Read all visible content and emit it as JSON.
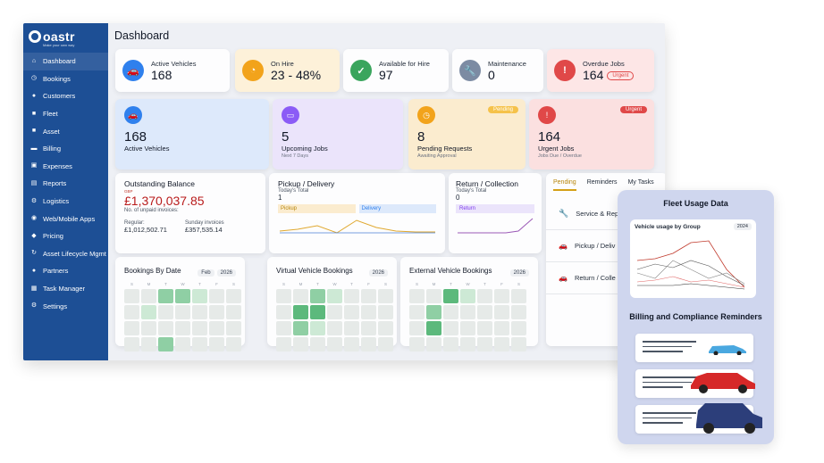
{
  "brand": {
    "name": "oastr",
    "tagline": "Make your own way"
  },
  "sidebar": {
    "items": [
      {
        "label": "Dashboard",
        "icon": "home-icon"
      },
      {
        "label": "Bookings",
        "icon": "clock-icon"
      },
      {
        "label": "Customers",
        "icon": "user-icon"
      },
      {
        "label": "Fleet",
        "icon": "truck-icon"
      },
      {
        "label": "Asset",
        "icon": "box-icon"
      },
      {
        "label": "Billing",
        "icon": "card-icon"
      },
      {
        "label": "Expenses",
        "icon": "wallet-icon"
      },
      {
        "label": "Reports",
        "icon": "report-icon"
      },
      {
        "label": "Logistics",
        "icon": "gear-icon"
      },
      {
        "label": "Web/Mobile Apps",
        "icon": "globe-icon"
      },
      {
        "label": "Pricing",
        "icon": "tag-icon"
      },
      {
        "label": "Asset Lifecycle Mgmt",
        "icon": "cycle-icon"
      },
      {
        "label": "Partners",
        "icon": "users-icon"
      },
      {
        "label": "Task Manager",
        "icon": "calendar-icon"
      },
      {
        "label": "Settings",
        "icon": "cog-icon"
      }
    ]
  },
  "header": {
    "title": "Dashboard"
  },
  "kpis": [
    {
      "label": "Active Vehicles",
      "value": "168",
      "color": "#2f80ed"
    },
    {
      "label": "On Hire",
      "value": "23 - 48%",
      "color": "#f2a31b"
    },
    {
      "label": "Available for Hire",
      "value": "97",
      "color": "#3aa55d"
    },
    {
      "label": "Maintenance",
      "value": "0",
      "color": "#7c8ba3"
    },
    {
      "label": "Overdue Jobs",
      "value": "164",
      "badge": "Urgent",
      "color": "#e04848"
    }
  ],
  "bigcards": [
    {
      "value": "168",
      "label": "Active Vehicles",
      "sub": "",
      "tag": "",
      "color": "#2f80ed",
      "bg": "#dde9fb"
    },
    {
      "value": "5",
      "label": "Upcoming Jobs",
      "sub": "Next 7 Days",
      "tag": "",
      "color": "#8b5cf6",
      "bg": "#ebe4fb"
    },
    {
      "value": "8",
      "label": "Pending Requests",
      "sub": "Awaiting Approval",
      "tag": "Pending",
      "color": "#f2a31b",
      "bg": "#fbeccf"
    },
    {
      "value": "164",
      "label": "Urgent Jobs",
      "sub": "Jobs Due / Overdue",
      "tag": "Urgent",
      "color": "#e04848",
      "bg": "#fbe0e0"
    }
  ],
  "balance": {
    "title": "Outstanding Balance",
    "caption": "GBP",
    "amount": "£1,370,037.85",
    "sub": "No. of unpaid invoices:",
    "regular_label": "Regular:",
    "regular_value": "£1,012,502.71",
    "sunday_label": "Sunday invoices",
    "sunday_value": "£357,535.14"
  },
  "pickup": {
    "title": "Pickup / Delivery",
    "sub": "Today's Total",
    "value": "1",
    "legend_a": "Pickup",
    "legend_b": "Delivery"
  },
  "returns": {
    "title": "Return / Collection",
    "sub": "Today's Total",
    "value": "0",
    "legend": "Return"
  },
  "tasks": {
    "tabs": [
      "Pending",
      "Reminders",
      "My Tasks"
    ],
    "rows": [
      {
        "label": "Service & Rep",
        "icon": "wrench-icon"
      },
      {
        "label": "Pickup / Deliv",
        "icon": "car-icon"
      },
      {
        "label": "Return / Colle",
        "icon": "car-icon"
      }
    ]
  },
  "calendars": [
    {
      "title": "Bookings By Date",
      "month": "Feb",
      "year": "2026"
    },
    {
      "title": "Virtual Vehicle Bookings",
      "month": "",
      "year": "2026"
    },
    {
      "title": "External Vehicle Bookings",
      "month": "",
      "year": "2026"
    }
  ],
  "weekdays": [
    "S",
    "M",
    "T",
    "W",
    "T",
    "F",
    "S"
  ],
  "overlay": {
    "title": "Fleet Usage Data",
    "chart_title": "Vehicle usage by Group",
    "chart_year": "2024",
    "reminders_title": "Billing and Compliance Reminders"
  }
}
